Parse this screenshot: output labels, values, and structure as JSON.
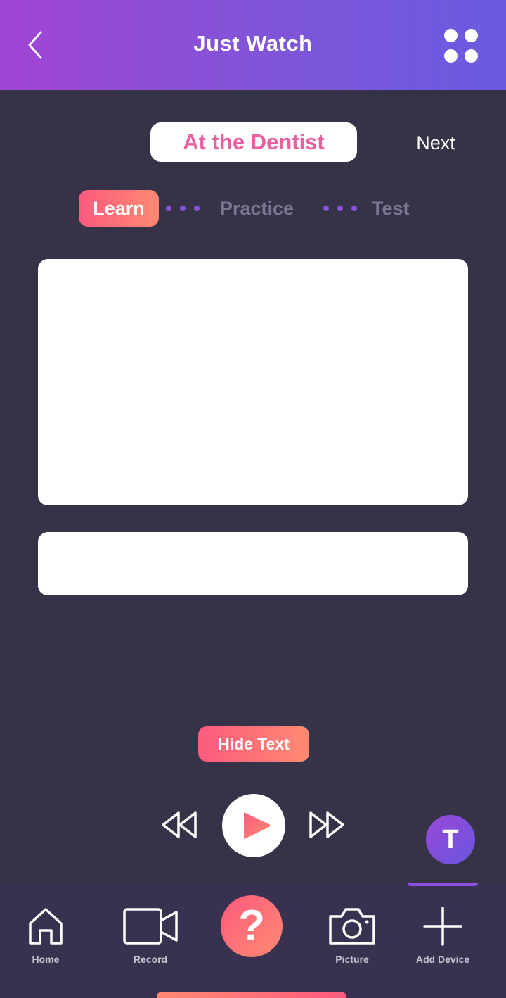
{
  "header": {
    "title": "Just Watch"
  },
  "lesson": {
    "topic": "At the Dentist",
    "next_label": "Next"
  },
  "steps": [
    {
      "label": "Learn",
      "active": true
    },
    {
      "label": "Practice",
      "active": false
    },
    {
      "label": "Test",
      "active": false
    }
  ],
  "controls": {
    "hide_text_label": "Hide Text"
  },
  "avatar": {
    "initial": "T"
  },
  "tabs": [
    {
      "label": "Home",
      "icon": "home-icon"
    },
    {
      "label": "Record",
      "icon": "video-camera-icon"
    },
    {
      "label": "",
      "icon": "question-icon"
    },
    {
      "label": "Picture",
      "icon": "camera-icon"
    },
    {
      "label": "Add Device",
      "icon": "plus-icon"
    }
  ],
  "help": {
    "symbol": "?"
  },
  "colors": {
    "header_gradient": [
      "#a045d4",
      "#6a5be0"
    ],
    "background": "#363349",
    "accent_pink": "#ea5f9f",
    "button_gradient": [
      "#fb5a7d",
      "#ff8a72"
    ],
    "step_dots": "#8a52e0"
  }
}
